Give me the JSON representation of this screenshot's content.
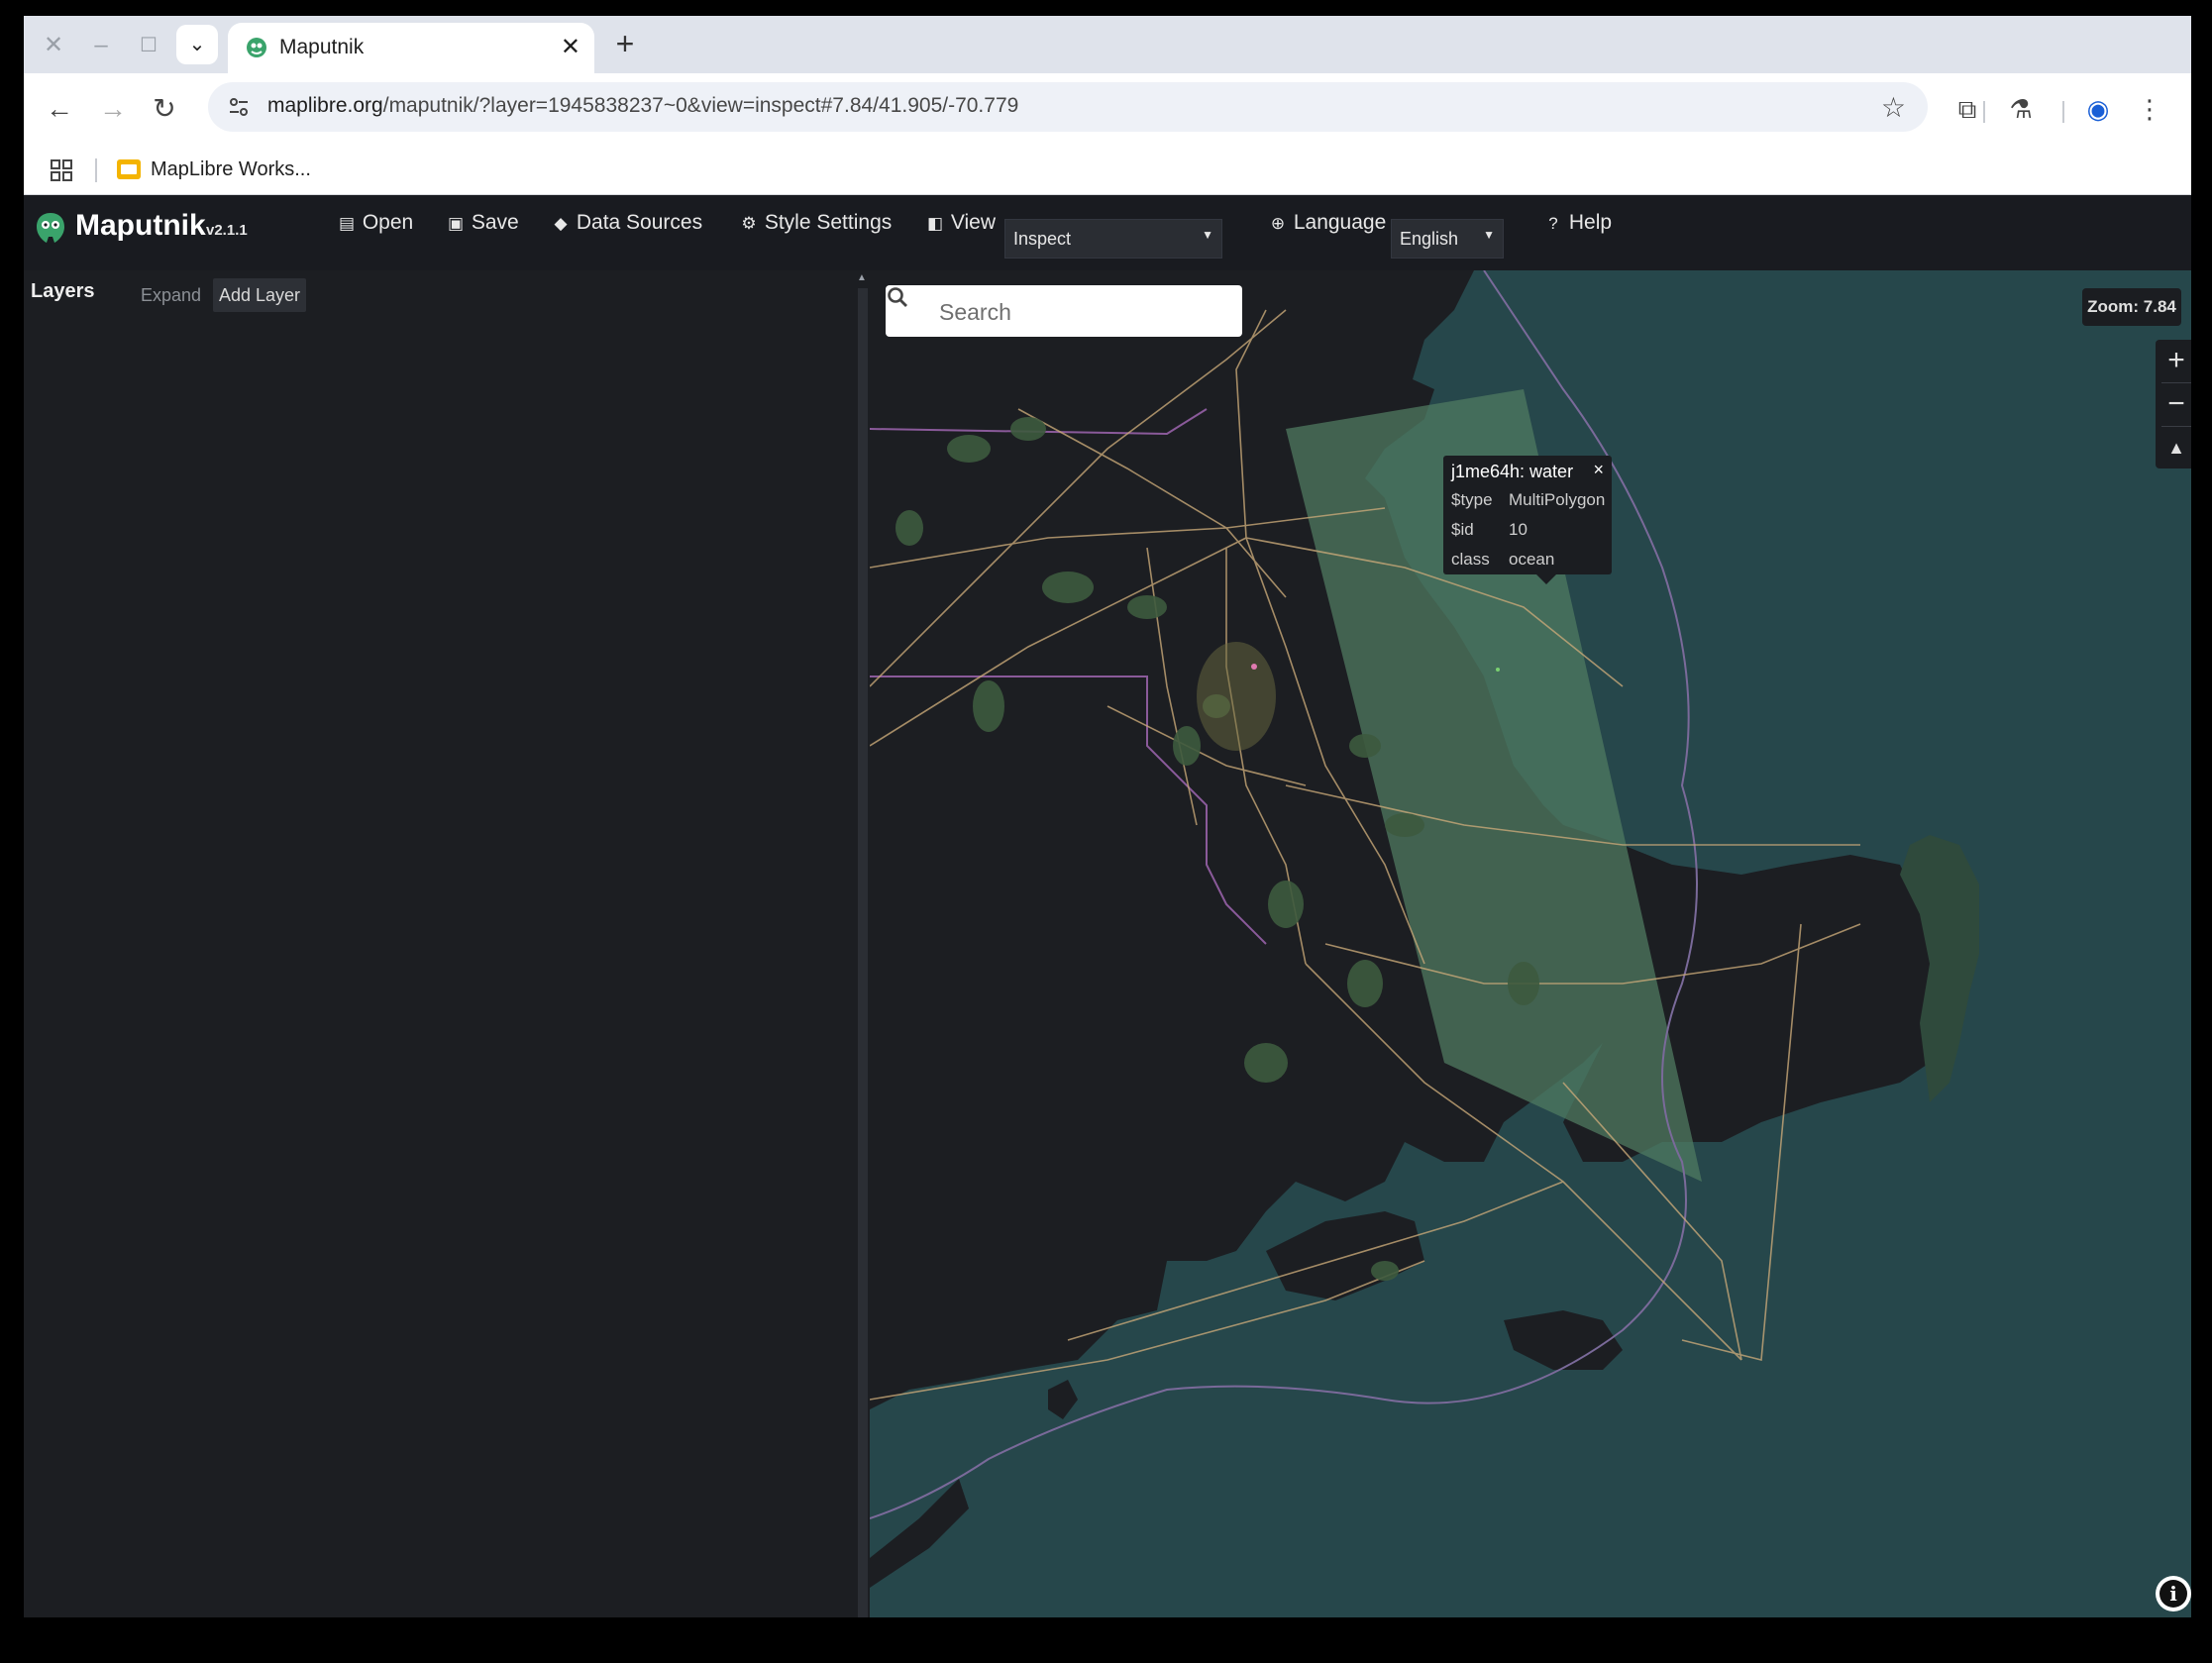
{
  "browser": {
    "tab": {
      "title": "Maputnik"
    },
    "url": {
      "host": "maplibre.org",
      "path": "/maputnik/?layer=1945838237~0&view=inspect#7.84/41.905/-70.779"
    },
    "bookmarks": [
      {
        "label": "MapLibre Works..."
      }
    ],
    "icons": [
      "close-icon",
      "minimize-icon",
      "maximize-icon",
      "tab-search-icon",
      "back-icon",
      "forward-icon",
      "reload-icon",
      "site-info-icon",
      "star-icon",
      "extensions-icon",
      "labs-icon",
      "profile-icon",
      "more-icon",
      "apps-icon"
    ]
  },
  "app": {
    "name": "Maputnik",
    "version": "v2.1.1",
    "menu": {
      "open": "Open",
      "save": "Save",
      "data_sources": "Data Sources",
      "style_settings": "Style Settings",
      "view": "View",
      "language": "Language",
      "help": "Help"
    },
    "view_select": {
      "value": "Inspect"
    },
    "language_select": {
      "value": "English"
    }
  },
  "sidebar": {
    "title": "Layers",
    "expand": "Expand",
    "add_layer": "Add Layer"
  },
  "map": {
    "search_placeholder": "Search",
    "zoom_label": "Zoom: 7.84",
    "zoom_in": "+",
    "zoom_out": "−",
    "popup": {
      "title": "j1me64h: water",
      "close": "×",
      "rows": [
        {
          "key": "$type",
          "value": "MultiPolygon"
        },
        {
          "key": "$id",
          "value": "10"
        },
        {
          "key": "class",
          "value": "ocean"
        }
      ]
    },
    "colors": {
      "water": "#26474b",
      "land": "#1c1e22",
      "park": "#3d5a3e",
      "roads": "#c8a878",
      "boundary": "#7a5a8a",
      "highlight": "#4f7a60"
    }
  }
}
